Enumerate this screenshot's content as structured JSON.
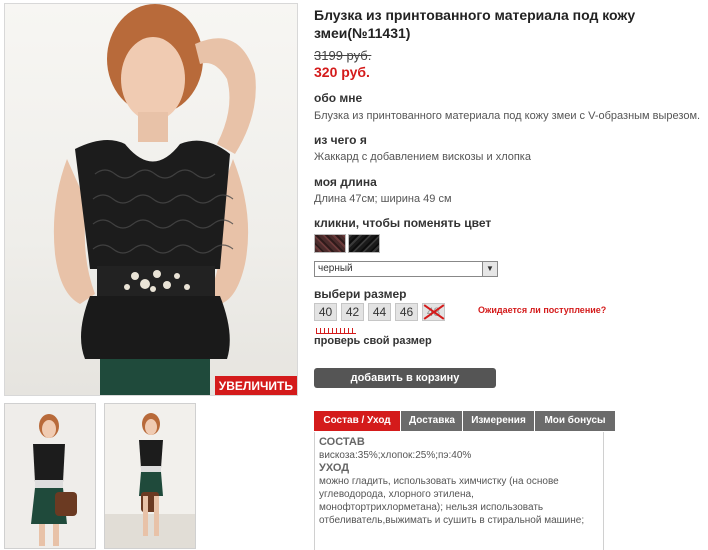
{
  "product": {
    "title": "Блузка из принтованного материала под кожу змеи(№11431)",
    "old_price": "3199 руб.",
    "new_price": "320 руб.",
    "zoom_label": "УВЕЛИЧИТЬ"
  },
  "about": {
    "heading": "обо мне",
    "text": "Блузка из принтованного материала под кожу змеи с V-образным вырезом."
  },
  "material": {
    "heading": "из чего я",
    "text": "Жаккард с добавлением вискозы и хлопка"
  },
  "length": {
    "heading": "моя длина",
    "text": "Длина 47см; ширина 49 см"
  },
  "color": {
    "heading": "кликни, чтобы поменять цвет",
    "selected": "черный",
    "swatches": [
      "burgundy-snake",
      "black-snake"
    ]
  },
  "sizes": {
    "heading": "выбери размер",
    "items": [
      "40",
      "42",
      "44",
      "46",
      "48"
    ],
    "unavailable": [
      "48"
    ],
    "availability_link": "Ожидается ли поступление?",
    "check_size": "проверь свой размер"
  },
  "cart": {
    "label": "добавить в корзину"
  },
  "tabs": {
    "items": [
      "Состав / Уход",
      "Доставка",
      "Измерения",
      "Мои бонусы"
    ],
    "active": "Состав / Уход"
  },
  "composition": {
    "heading": "СОСТАВ",
    "text": "вискоза:35%;хлопок:25%;пэ:40%",
    "care_heading": "УХОД",
    "care_text": "можно гладить, использовать химчистку (на основе углеводорода, хлорного этилена, монофтортрихлорметана); нельзя использовать отбеливатель,выжимать и сушить в стиральной машине;"
  },
  "colors": {
    "accent": "#d41b1b",
    "button": "#555555",
    "tab_inactive": "#6b6b6b"
  }
}
